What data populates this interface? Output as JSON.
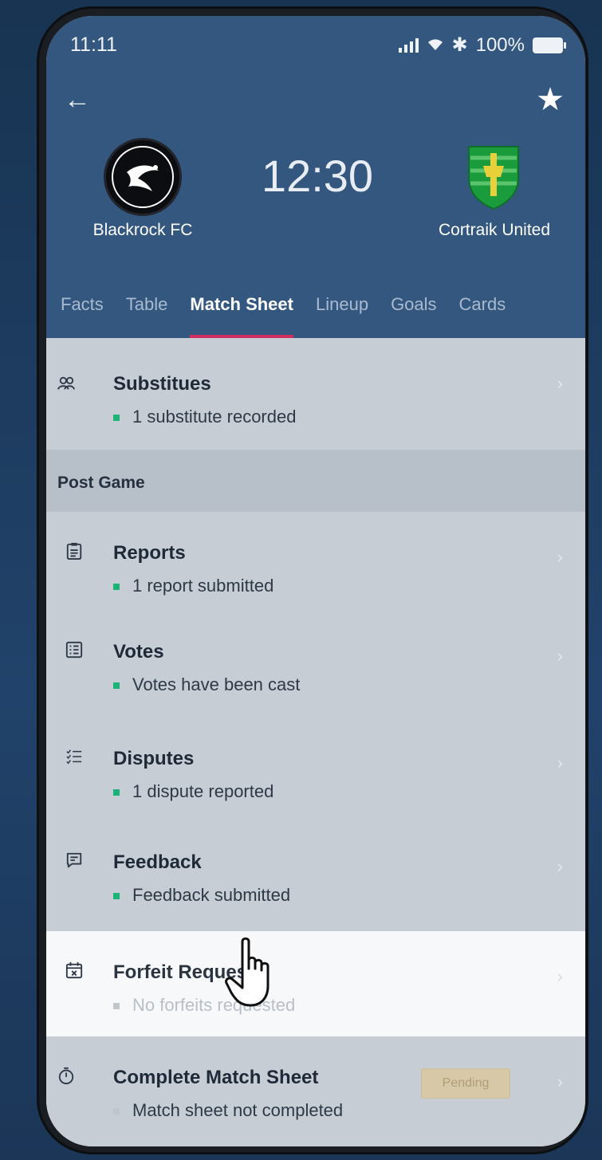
{
  "status_bar": {
    "time": "11:11",
    "battery": "100%"
  },
  "header": {
    "home_team": "Blackrock FC",
    "away_team": "Cortraik United",
    "kickoff_time": "12:30"
  },
  "tabs": [
    {
      "label": "Facts",
      "active": false
    },
    {
      "label": "Table",
      "active": false
    },
    {
      "label": "Match Sheet",
      "active": true
    },
    {
      "label": "Lineup",
      "active": false
    },
    {
      "label": "Goals",
      "active": false
    },
    {
      "label": "Cards",
      "active": false
    }
  ],
  "substitutes": {
    "title": "Substitues",
    "status": "1 substitute recorded"
  },
  "post_game": {
    "section_label": "Post Game",
    "items": [
      {
        "title": "Reports",
        "status": "1 report submitted"
      },
      {
        "title": "Votes",
        "status": "Votes have been cast"
      },
      {
        "title": "Disputes",
        "status": "1 dispute reported"
      },
      {
        "title": "Feedback",
        "status": "Feedback submitted"
      },
      {
        "title": "Forfeit Request",
        "status": "No forfeits requested"
      },
      {
        "title": "Complete Match Sheet",
        "status": "Match sheet not completed",
        "badge": "Pending"
      }
    ]
  },
  "colors": {
    "header": "#33577f",
    "accent": "#d02d5f",
    "ok": "#1db377"
  }
}
